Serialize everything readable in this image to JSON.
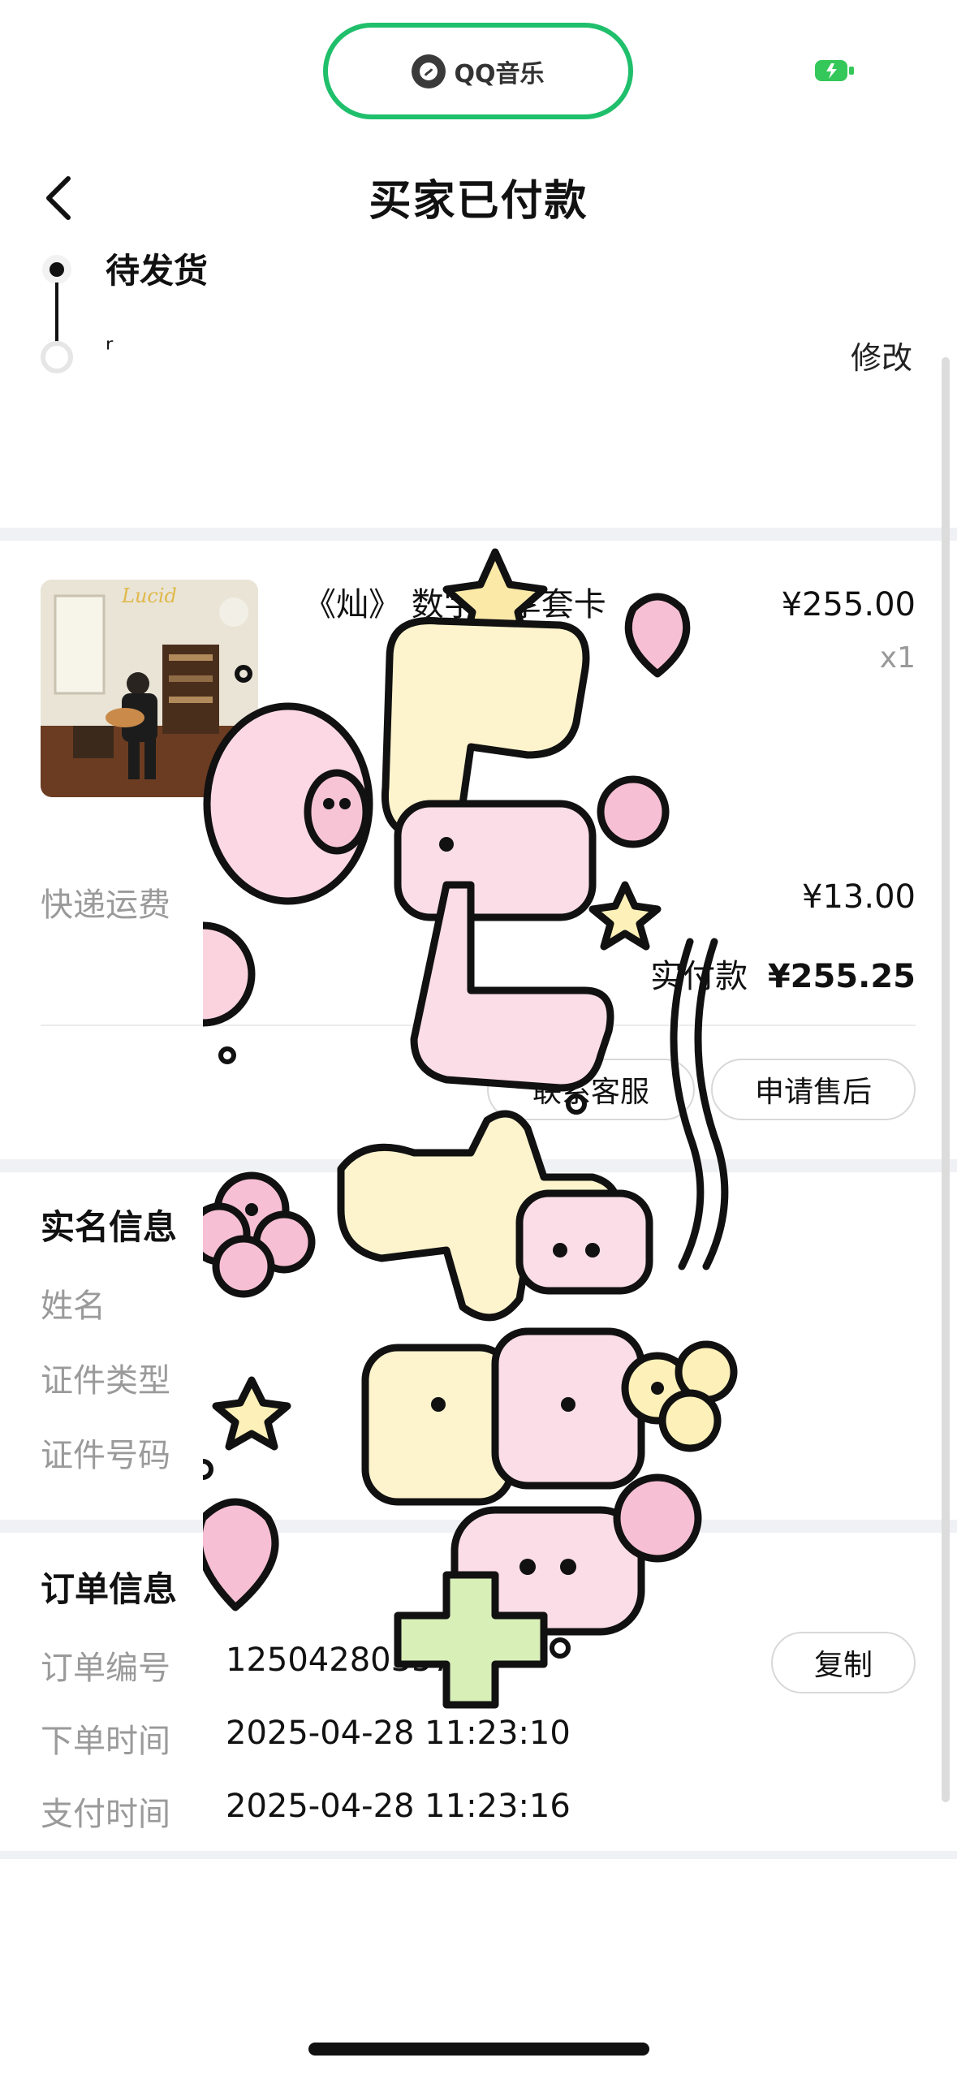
{
  "app": {
    "pill_label": "QQ音乐",
    "title": "买家已付款"
  },
  "timeline": {
    "status": "待发货",
    "address_fragment": "ʳ",
    "modify_label": "修改"
  },
  "product": {
    "name": "《灿》 数字专享套卡",
    "price": "¥255.00",
    "quantity": "x1",
    "album_text": "Lucid"
  },
  "fees": {
    "shipping_label": "快递运费",
    "shipping_value": "¥13.00",
    "paid_label": "实付款",
    "paid_value": "¥255.25"
  },
  "actions": {
    "contact_label": "联系客服",
    "after_sale_label": "申请售后"
  },
  "realname": {
    "title": "实名信息",
    "name_label": "姓名",
    "id_type_label": "证件类型",
    "id_number_label": "证件号码"
  },
  "order": {
    "title": "订单信息",
    "number_label": "订单编号",
    "number_value": "12504280357",
    "copy_label": "复制",
    "created_label": "下单时间",
    "created_value": "2025-04-28 11:23:10",
    "paid_label": "支付时间",
    "paid_value": "2025-04-28 11:23:16"
  },
  "colors": {
    "accent_green": "#1fbf6b",
    "divider": "#f0f1f5",
    "muted_text": "#9a9a9a"
  },
  "icons": [
    "qq-music-logo-icon",
    "battery-charging-icon",
    "back-chevron-icon",
    "scroll-indicator"
  ]
}
